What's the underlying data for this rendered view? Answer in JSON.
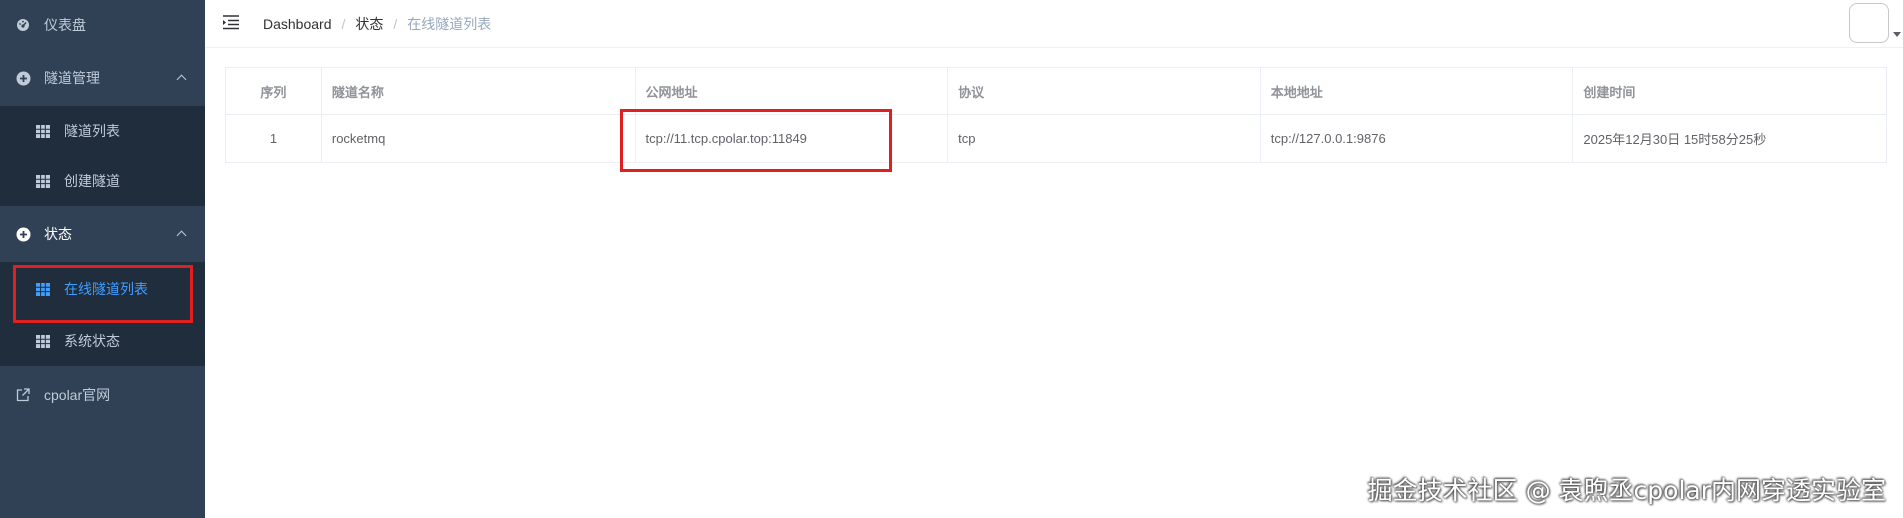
{
  "sidebar": {
    "dashboard": "仪表盘",
    "tunnel_mgmt": "隧道管理",
    "tunnel_list": "隧道列表",
    "create_tunnel": "创建隧道",
    "status": "状态",
    "online_tunnels": "在线隧道列表",
    "system_status": "系统状态",
    "cpolar_site": "cpolar官网"
  },
  "breadcrumb": [
    "Dashboard",
    "状态",
    "在线隧道列表"
  ],
  "table": {
    "headers": [
      "序列",
      "隧道名称",
      "公网地址",
      "协议",
      "本地地址",
      "创建时间"
    ],
    "rows": [
      [
        "1",
        "rocketmq",
        "tcp://11.tcp.cpolar.top:11849",
        "tcp",
        "tcp://127.0.0.1:9876",
        "2025年12月30日 15时58分25秒"
      ]
    ]
  },
  "watermark": "掘金技术社区 @ 袁煦丞cpolar内网穿透实验室",
  "colors": {
    "sidebar_bg": "#304156",
    "submenu_bg": "#1f2d3d",
    "active": "#409eff",
    "highlight": "#e02020"
  }
}
